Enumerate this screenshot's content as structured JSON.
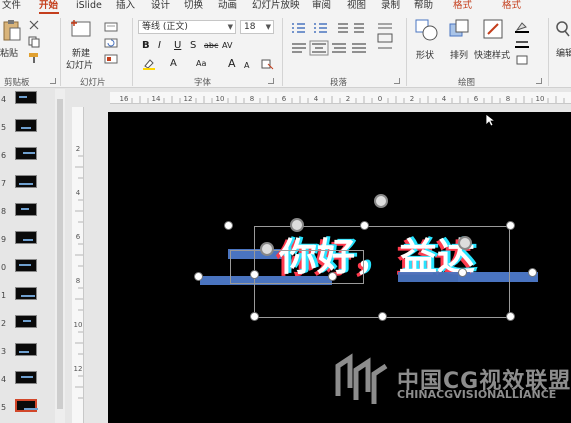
{
  "tabs": [
    "文件",
    "开始",
    "iSlide",
    "插入",
    "设计",
    "切换",
    "动画",
    "幻灯片放映",
    "审阅",
    "视图",
    "录制",
    "帮助",
    "格式",
    "格式"
  ],
  "ribbon": {
    "clipboard": {
      "paste": "粘贴",
      "group": "剪贴板"
    },
    "slides": {
      "new_slide_1": "新建",
      "new_slide_2": "幻灯片",
      "group": "幻灯片"
    },
    "font": {
      "font_name": "等线 (正文)",
      "font_size": "18",
      "group": "字体",
      "bold": "B",
      "italic": "I",
      "underline": "U",
      "shadow": "S",
      "strike": "abc",
      "spacing": "AV",
      "grow": "A",
      "shrink": "A",
      "case": "Aa",
      "clear": "A"
    },
    "paragraph": {
      "group": "段落"
    },
    "drawing": {
      "shape": "形状",
      "arrange": "排列",
      "quick_style": "快速样式",
      "group": "绘图"
    },
    "editing": {
      "label": "编辑"
    }
  },
  "thumbnails": {
    "numbers": [
      "4",
      "5",
      "6",
      "7",
      "8",
      "9",
      "0",
      "1",
      "2",
      "3",
      "4",
      "5"
    ],
    "selected_index": 11
  },
  "ruler": {
    "h_labels": [
      "16",
      "14",
      "12",
      "10",
      "8",
      "6",
      "4",
      "2",
      "0",
      "2",
      "4",
      "6",
      "8",
      "10"
    ],
    "v_labels": [
      "2",
      "4",
      "6",
      "8",
      "10",
      "12"
    ]
  },
  "slide": {
    "text_left": "你好，",
    "text_right": "益达",
    "watermark_cn": "中国CG视效联盟",
    "watermark_en": "CHINACGVISIONALLIANCE"
  },
  "colors": {
    "accent": "#c43e1c",
    "bar": "#4a74c0",
    "slide_bg": "#000000",
    "glitch_red": "#ff3b4e",
    "glitch_cyan": "#27e3ff"
  }
}
